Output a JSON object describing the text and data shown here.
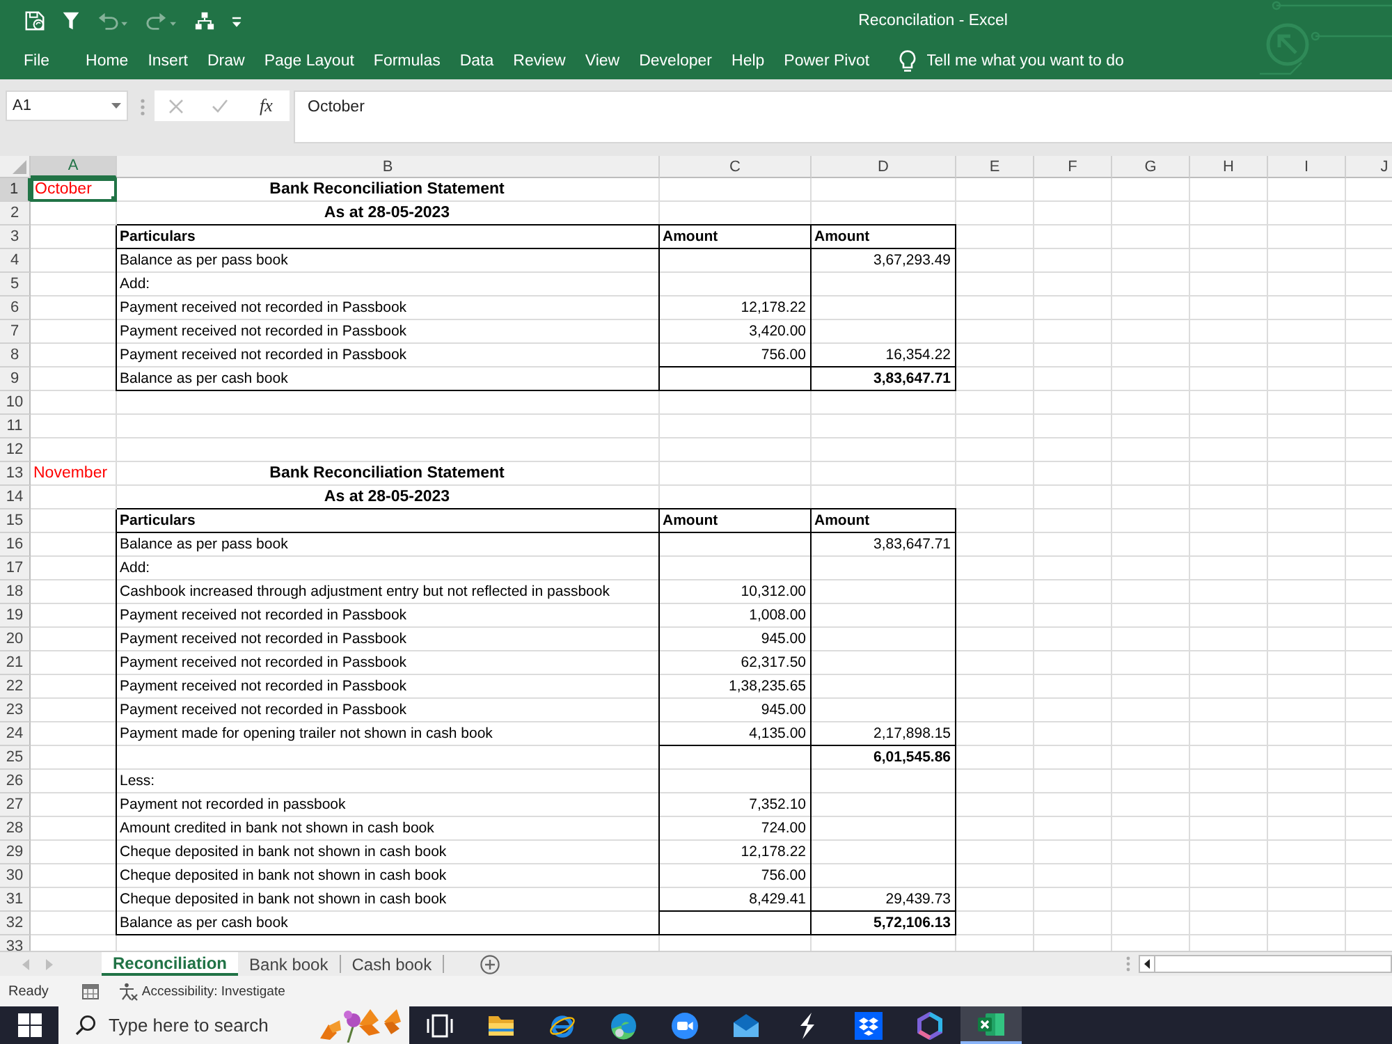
{
  "window": {
    "title": "Reconcilation - Excel"
  },
  "quick_access": [
    {
      "kind": "autosave",
      "disabled": false
    },
    {
      "kind": "filter",
      "disabled": false
    },
    {
      "kind": "undo",
      "disabled": true
    },
    {
      "kind": "redo",
      "disabled": true
    },
    {
      "kind": "hierarchy",
      "disabled": false
    },
    {
      "kind": "customize",
      "disabled": false
    }
  ],
  "ribbon_tabs": [
    "File",
    "Home",
    "Insert",
    "Draw",
    "Page Layout",
    "Formulas",
    "Data",
    "Review",
    "View",
    "Developer",
    "Help",
    "Power Pivot"
  ],
  "tell_me": {
    "placeholder": "Tell me what you want to do"
  },
  "formula_bar": {
    "name_box": "A1",
    "buttons": [
      {
        "kind": "cancel",
        "disabled": true
      },
      {
        "kind": "enter",
        "disabled": true
      },
      {
        "kind": "function",
        "label": "fx",
        "disabled": false
      }
    ],
    "value": "October"
  },
  "sheet": {
    "columns": [
      {
        "label": "A",
        "selected": true
      },
      {
        "label": "B",
        "selected": false
      },
      {
        "label": "C",
        "selected": false
      },
      {
        "label": "D",
        "selected": false
      },
      {
        "label": "E",
        "selected": false
      },
      {
        "label": "F",
        "selected": false
      },
      {
        "label": "G",
        "selected": false
      },
      {
        "label": "H",
        "selected": false
      },
      {
        "label": "I",
        "selected": false
      },
      {
        "label": "J",
        "selected": false
      }
    ],
    "rows": [
      {
        "number": "1",
        "selected": true,
        "kind": "title",
        "a": "October",
        "b": "Bank Reconciliation Statement"
      },
      {
        "number": "2",
        "selected": false,
        "kind": "title",
        "b": "As at 28-05-2023"
      },
      {
        "number": "3",
        "selected": false,
        "kind": "header",
        "b": "Particulars",
        "c": "Amount",
        "d": "Amount"
      },
      {
        "number": "4",
        "selected": false,
        "kind": "item",
        "b": "Balance as per pass book",
        "d": "3,67,293.49"
      },
      {
        "number": "5",
        "selected": false,
        "kind": "item",
        "b": "Add:"
      },
      {
        "number": "6",
        "selected": false,
        "kind": "item",
        "b": "Payment received not recorded in Passbook",
        "c": "12,178.22"
      },
      {
        "number": "7",
        "selected": false,
        "kind": "item",
        "b": "Payment received not recorded in Passbook",
        "c": "3,420.00"
      },
      {
        "number": "8",
        "selected": false,
        "kind": "item_ruled",
        "b": "Payment received not recorded in Passbook",
        "c": "756.00",
        "d": "16,354.22"
      },
      {
        "number": "9",
        "selected": false,
        "kind": "total_end",
        "b": "Balance as per cash book",
        "d": "3,83,647.71"
      },
      {
        "number": "10",
        "selected": false,
        "kind": "blank"
      },
      {
        "number": "11",
        "selected": false,
        "kind": "blank"
      },
      {
        "number": "12",
        "selected": false,
        "kind": "blank"
      },
      {
        "number": "13",
        "selected": false,
        "kind": "title",
        "a": "November",
        "b": "Bank Reconciliation Statement"
      },
      {
        "number": "14",
        "selected": false,
        "kind": "title",
        "b": "As at 28-05-2023"
      },
      {
        "number": "15",
        "selected": false,
        "kind": "header",
        "b": "Particulars",
        "c": "Amount",
        "d": "Amount"
      },
      {
        "number": "16",
        "selected": false,
        "kind": "item",
        "b": "Balance as per pass book",
        "d": "3,83,647.71"
      },
      {
        "number": "17",
        "selected": false,
        "kind": "item",
        "b": "Add:"
      },
      {
        "number": "18",
        "selected": false,
        "kind": "item",
        "b": "Cashbook increased through adjustment entry but not reflected in passbook",
        "c": "10,312.00"
      },
      {
        "number": "19",
        "selected": false,
        "kind": "item",
        "b": "Payment received not recorded in Passbook",
        "c": "1,008.00"
      },
      {
        "number": "20",
        "selected": false,
        "kind": "item",
        "b": "Payment received not recorded in Passbook",
        "c": "945.00"
      },
      {
        "number": "21",
        "selected": false,
        "kind": "item",
        "b": "Payment received not recorded in Passbook",
        "c": "62,317.50"
      },
      {
        "number": "22",
        "selected": false,
        "kind": "item",
        "b": "Payment received not recorded in Passbook",
        "c": "1,38,235.65"
      },
      {
        "number": "23",
        "selected": false,
        "kind": "item",
        "b": "Payment received not recorded in Passbook",
        "c": "945.00"
      },
      {
        "number": "24",
        "selected": false,
        "kind": "item_ruled",
        "b": "Payment made for opening trailer not shown in cash book",
        "c": "4,135.00",
        "d": "2,17,898.15"
      },
      {
        "number": "25",
        "selected": false,
        "kind": "total",
        "d": "6,01,545.86"
      },
      {
        "number": "26",
        "selected": false,
        "kind": "item",
        "b": "Less:"
      },
      {
        "number": "27",
        "selected": false,
        "kind": "item",
        "b": "Payment not recorded in passbook",
        "c": "7,352.10"
      },
      {
        "number": "28",
        "selected": false,
        "kind": "item",
        "b": "Amount credited in bank not shown in cash book",
        "c": "724.00"
      },
      {
        "number": "29",
        "selected": false,
        "kind": "item",
        "b": "Cheque deposited in bank not shown in cash book",
        "c": "12,178.22"
      },
      {
        "number": "30",
        "selected": false,
        "kind": "item",
        "b": "Cheque deposited in bank not shown in cash book",
        "c": "756.00"
      },
      {
        "number": "31",
        "selected": false,
        "kind": "item_ruled",
        "b": "Cheque deposited in bank not shown in cash book",
        "c": "8,429.41",
        "d": "29,439.73"
      },
      {
        "number": "32",
        "selected": false,
        "kind": "total_end",
        "b": "Balance as per cash book",
        "d": "5,72,106.13"
      },
      {
        "number": "33",
        "selected": false,
        "kind": "blank"
      }
    ]
  },
  "sheet_tabs": [
    {
      "label": "Reconciliation",
      "selected": true
    },
    {
      "label": "Bank book",
      "selected": false
    },
    {
      "label": "Cash book",
      "selected": false
    }
  ],
  "status_bar": {
    "mode": "Ready",
    "accessibility": "Accessibility: Investigate"
  },
  "taskbar": {
    "search": {
      "placeholder": "Type here to search"
    },
    "apps": [
      {
        "kind": "task_view",
        "active": false
      },
      {
        "kind": "file_explorer",
        "active": false
      },
      {
        "kind": "internet_explorer",
        "active": false
      },
      {
        "kind": "edge",
        "active": false
      },
      {
        "kind": "zoom",
        "active": false
      },
      {
        "kind": "mail",
        "active": false
      },
      {
        "kind": "s_app",
        "active": false
      },
      {
        "kind": "dropbox",
        "active": false
      },
      {
        "kind": "copilot",
        "active": false
      },
      {
        "kind": "excel",
        "active": true
      }
    ]
  }
}
